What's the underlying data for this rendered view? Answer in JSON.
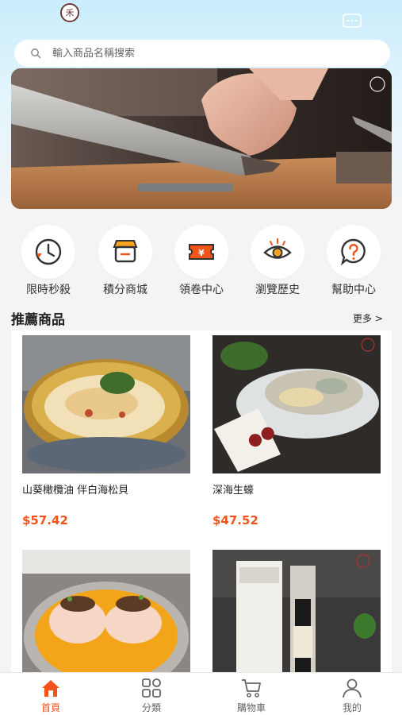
{
  "header": {
    "logo_text": "禾",
    "logo_caption": "禾",
    "search_placeholder": "輸入商品名稱搜索"
  },
  "categories": [
    {
      "label": "限時秒殺",
      "icon": "clock-icon"
    },
    {
      "label": "積分商城",
      "icon": "store-icon"
    },
    {
      "label": "領卷中心",
      "icon": "ticket-icon"
    },
    {
      "label": "瀏覽歷史",
      "icon": "eye-icon"
    },
    {
      "label": "幫助中心",
      "icon": "help-icon"
    }
  ],
  "recommend": {
    "title": "推薦商品",
    "more": "更多 >"
  },
  "products": [
    {
      "name": "山葵橄欖油 伴白海松貝",
      "price": "$57.42"
    },
    {
      "name": "深海生蠔",
      "price": "$47.52"
    },
    {
      "name": "",
      "price": ""
    },
    {
      "name": "",
      "price": ""
    }
  ],
  "tabbar": [
    {
      "label": "首頁",
      "icon": "home-icon",
      "active": true
    },
    {
      "label": "分類",
      "icon": "grid-icon",
      "active": false
    },
    {
      "label": "購物車",
      "icon": "cart-icon",
      "active": false
    },
    {
      "label": "我的",
      "icon": "user-icon",
      "active": false
    }
  ],
  "colors": {
    "accent": "#f2531b",
    "header_gradient_top": "#c9ecfb"
  }
}
